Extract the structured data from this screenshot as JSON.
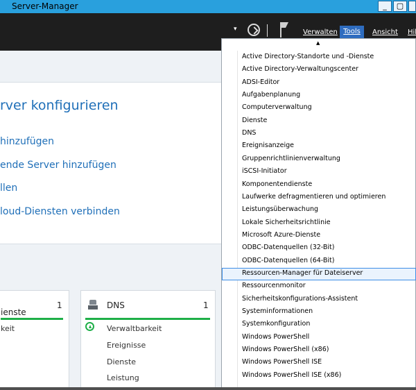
{
  "window": {
    "title": "Server-Manager",
    "minimize": "_",
    "maximize": "▢"
  },
  "header": {
    "menu_caret": "▾",
    "verwalten": "Verwalten",
    "tools": "Tools",
    "ansicht": "Ansicht",
    "hilfe": "Hilfe"
  },
  "quick_start": {
    "title": "rver konfigurieren",
    "links": [
      "hinzufügen",
      "ende Server hinzufügen",
      "llen",
      "loud-Diensten verbinden"
    ]
  },
  "tiles": [
    {
      "title": "ienste",
      "count": "1",
      "rows": [
        "keit"
      ]
    },
    {
      "title": "DNS",
      "count": "1",
      "rows": [
        "Verwaltbarkeit",
        "Ereignisse",
        "Dienste",
        "Leistung"
      ]
    }
  ],
  "tools_menu": {
    "arrow": "▲",
    "items": [
      "Active Directory-Standorte und -Dienste",
      "Active Directory-Verwaltungscenter",
      "ADSI-Editor",
      "Aufgabenplanung",
      "Computerverwaltung",
      "Dienste",
      "DNS",
      "Ereignisanzeige",
      "Gruppenrichtlinienverwaltung",
      "iSCSI-Initiator",
      "Komponentendienste",
      "Laufwerke defragmentieren und optimieren",
      "Leistungsüberwachung",
      "Lokale Sicherheitsrichtlinie",
      "Microsoft Azure-Dienste",
      "ODBC-Datenquellen (32-Bit)",
      "ODBC-Datenquellen (64-Bit)",
      "Ressourcen-Manager für Dateiserver",
      "Ressourcenmonitor",
      "Sicherheitskonfigurations-Assistent",
      "Systeminformationen",
      "Systemkonfiguration",
      "Windows PowerShell",
      "Windows PowerShell (x86)",
      "Windows PowerShell ISE",
      "Windows PowerShell ISE (x86)"
    ],
    "highlighted_index": 17
  }
}
